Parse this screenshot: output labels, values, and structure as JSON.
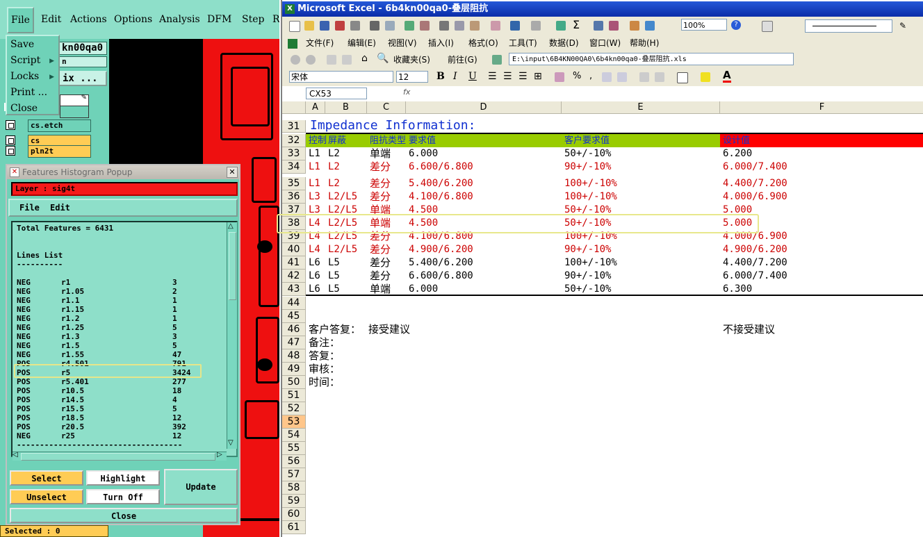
{
  "cam": {
    "menu": [
      "File",
      "Edit",
      "Actions",
      "Options",
      "Analysis",
      "DFM",
      "Step",
      "R"
    ],
    "file_menu": {
      "items": [
        "Save",
        "Script",
        "Locks",
        "Print ...",
        "Close"
      ]
    },
    "job_name": "kn00qa0",
    "job_sub": "n",
    "matrix_btn": "ix ...",
    "layers": [
      {
        "name": "cs.etch",
        "color": "#6fd2b8"
      },
      {
        "name": "cs",
        "color": "#ffcc55"
      },
      {
        "name": "pln2t",
        "color": "#ffcc55"
      }
    ],
    "popup": {
      "title": "Features Histogram Popup",
      "layer_label": "Layer :  sig4t",
      "menu": [
        "File",
        "Edit"
      ],
      "total": "Total Features = 6431",
      "list_title": "Lines List",
      "list_sep": "----------",
      "rows": [
        [
          "NEG",
          "r1",
          "3"
        ],
        [
          "NEG",
          "r1.05",
          "2"
        ],
        [
          "NEG",
          "r1.1",
          "1"
        ],
        [
          "NEG",
          "r1.15",
          "1"
        ],
        [
          "NEG",
          "r1.2",
          "1"
        ],
        [
          "NEG",
          "r1.25",
          "5"
        ],
        [
          "NEG",
          "r1.3",
          "3"
        ],
        [
          "NEG",
          "r1.5",
          "5"
        ],
        [
          "NEG",
          "r1.55",
          "47"
        ],
        [
          "POS",
          "r4.501",
          "791"
        ],
        [
          "POS",
          "r5",
          "3424"
        ],
        [
          "POS",
          "r5.401",
          "277"
        ],
        [
          "POS",
          "r10.5",
          "18"
        ],
        [
          "POS",
          "r14.5",
          "4"
        ],
        [
          "POS",
          "r15.5",
          "5"
        ],
        [
          "POS",
          "r18.5",
          "12"
        ],
        [
          "POS",
          "r20.5",
          "392"
        ],
        [
          "NEG",
          "r25",
          "12"
        ]
      ],
      "end_sep": "------------------------------------",
      "buttons": {
        "select": "Select",
        "highlight": "Highlight",
        "update": "Update",
        "unselect": "Unselect",
        "turn_off": "Turn Off",
        "close": "Close"
      }
    },
    "status": "Selected : 0"
  },
  "excel": {
    "title": "Microsoft Excel - 6b4kn00qa0-叠层阻抗",
    "zoom": "100%",
    "menu": [
      "文件(F)",
      "编辑(E)",
      "视图(V)",
      "插入(I)",
      "格式(O)",
      "工具(T)",
      "数据(D)",
      "窗口(W)",
      "帮助(H)"
    ],
    "web_bar": {
      "favorites": "收藏夹(S)",
      "goto": "前往(G)",
      "path": "E:\\input\\6B4KN00QA0\\6b4kn00qa0-叠层阻抗.xls"
    },
    "font": "宋体",
    "font_size": "12",
    "name_box": "CX53",
    "fx": "fx",
    "columns": [
      "A",
      "B",
      "C",
      "D",
      "E",
      "F"
    ],
    "selected_row": "53",
    "heading": "Impedance Information:",
    "header_row": {
      "a": "控制",
      "b": "屏蔽",
      "c": "阻抗类型",
      "d": "要求值",
      "e": "客户要求值",
      "f": "设计值"
    },
    "rows": [
      {
        "n": "33",
        "a": "L1",
        "b": "L2",
        "c": "单端",
        "d": "6.000",
        "e": "50+/-10%",
        "f": "6.200",
        "red": false
      },
      {
        "n": "34",
        "a": "L1",
        "b": "L2",
        "c": "差分",
        "d": "6.600/6.800",
        "e": "90+/-10%",
        "f": "6.000/7.400",
        "red": true
      },
      {
        "n": "35",
        "a": "L1",
        "b": "L2",
        "c": "差分",
        "d": "5.400/6.200",
        "e": "100+/-10%",
        "f": "4.400/7.200",
        "red": true
      },
      {
        "n": "36",
        "a": "L3",
        "b": "L2/L5",
        "c": "差分",
        "d": "4.100/6.800",
        "e": "100+/-10%",
        "f": "4.000/6.900",
        "red": true
      },
      {
        "n": "37",
        "a": "L3",
        "b": "L2/L5",
        "c": "单端",
        "d": "4.500",
        "e": "50+/-10%",
        "f": "5.000",
        "red": true
      },
      {
        "n": "38",
        "a": "L4",
        "b": "L2/L5",
        "c": "单端",
        "d": "4.500",
        "e": "50+/-10%",
        "f": "5.000",
        "red": true
      },
      {
        "n": "39",
        "a": "L4",
        "b": "L2/L5",
        "c": "差分",
        "d": "4.100/6.800",
        "e": "100+/-10%",
        "f": "4.000/6.900",
        "red": true
      },
      {
        "n": "40",
        "a": "L4",
        "b": "L2/L5",
        "c": "差分",
        "d": "4.900/6.200",
        "e": "90+/-10%",
        "f": "4.900/6.200",
        "red": true
      },
      {
        "n": "41",
        "a": "L6",
        "b": "L5",
        "c": "差分",
        "d": "5.400/6.200",
        "e": "100+/-10%",
        "f": "4.400/7.200",
        "red": false
      },
      {
        "n": "42",
        "a": "L6",
        "b": "L5",
        "c": "差分",
        "d": "6.600/6.800",
        "e": "90+/-10%",
        "f": "6.000/7.400",
        "red": false
      },
      {
        "n": "43",
        "a": "L6",
        "b": "L5",
        "c": "单端",
        "d": "6.000",
        "e": "50+/-10%",
        "f": "6.300",
        "red": false
      }
    ],
    "footer": {
      "customer_reply": "客户答复：",
      "accept": "接受建议",
      "reject": "不接受建议",
      "remark": "备注：",
      "reply": "答复：",
      "review": "审核：",
      "time": "时间："
    },
    "row_numbers_top": [
      "31",
      "32"
    ],
    "row_numbers_bottom": [
      "44",
      "45",
      "46",
      "47",
      "48",
      "49",
      "50",
      "51",
      "52",
      "53",
      "54",
      "55",
      "56",
      "57",
      "58",
      "59",
      "60",
      "61"
    ]
  }
}
